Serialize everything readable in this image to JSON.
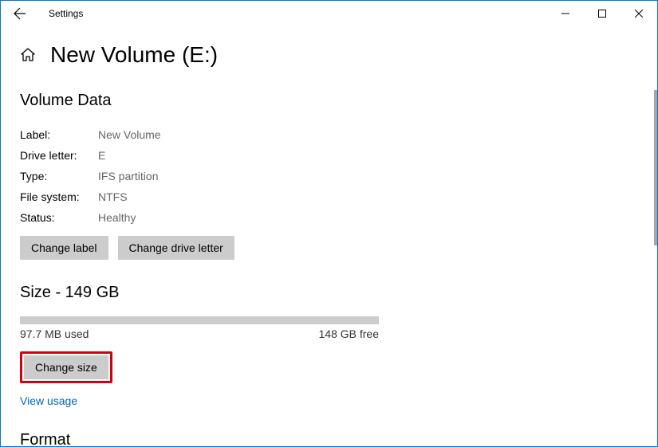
{
  "titlebar": {
    "title": "Settings"
  },
  "page": {
    "title": "New Volume (E:)"
  },
  "volumeData": {
    "heading": "Volume Data",
    "rows": {
      "label_key": "Label:",
      "label_val": "New Volume",
      "drive_key": "Drive letter:",
      "drive_val": "E",
      "type_key": "Type:",
      "type_val": "IFS partition",
      "fs_key": "File system:",
      "fs_val": "NTFS",
      "status_key": "Status:",
      "status_val": "Healthy"
    },
    "change_label_btn": "Change label",
    "change_drive_btn": "Change drive letter"
  },
  "size": {
    "heading": "Size - 149 GB",
    "used": "97.7 MB used",
    "free": "148 GB free",
    "change_size_btn": "Change size",
    "view_usage_link": "View usage"
  },
  "format": {
    "heading": "Format"
  }
}
